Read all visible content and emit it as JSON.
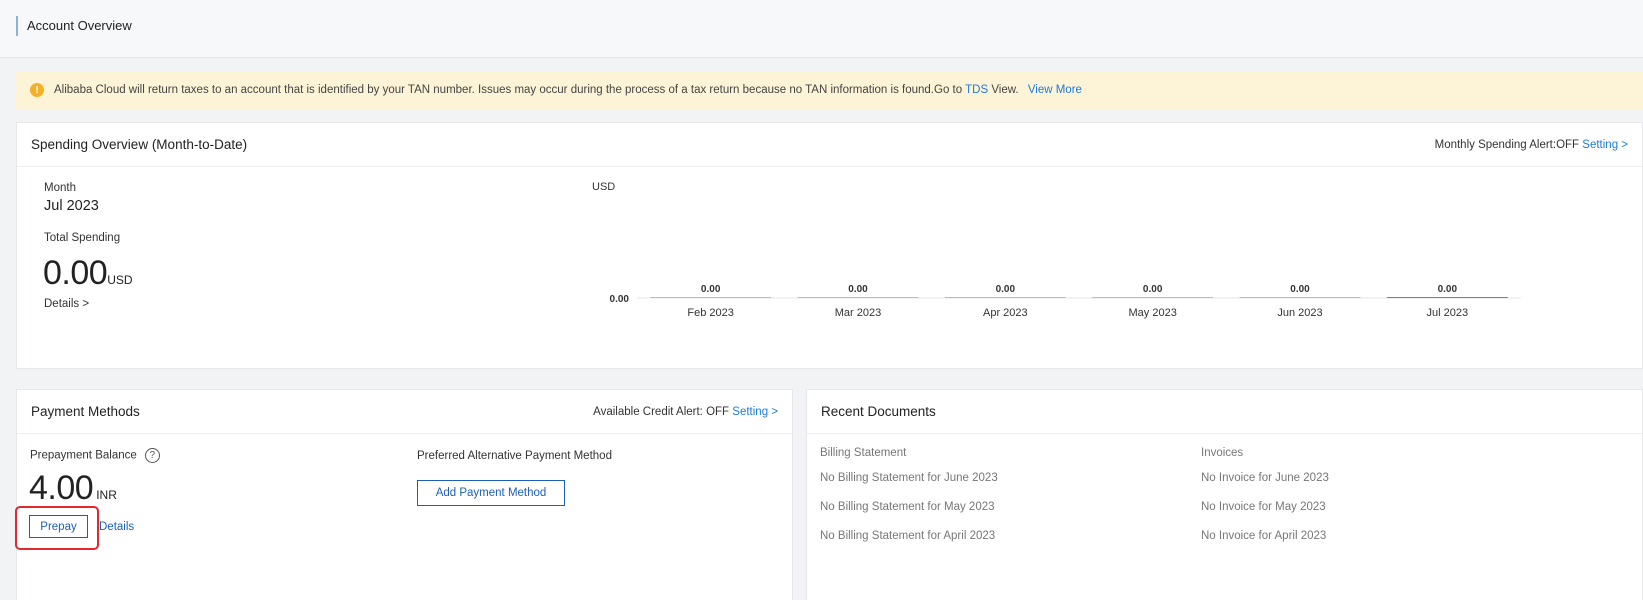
{
  "page": {
    "title": "Account Overview"
  },
  "notice": {
    "text": "Alibaba Cloud will return taxes to an account that is identified by your TAN number. Issues may occur during the process of a tax return because no TAN information is found.Go to ",
    "tds_link": "TDS",
    "view_text": " View.",
    "view_more": "View More"
  },
  "spending": {
    "title": "Spending Overview (Month-to-Date)",
    "alert_text": "Monthly Spending Alert:OFF",
    "setting_link": "Setting >",
    "month_label": "Month",
    "month_value": "Jul 2023",
    "total_label": "Total Spending",
    "total_value": "0.00",
    "total_unit": "USD",
    "details_link": "Details >"
  },
  "chart_data": {
    "type": "bar",
    "ylabel": "USD",
    "categories": [
      "Feb 2023",
      "Mar 2023",
      "Apr 2023",
      "May 2023",
      "Jun 2023",
      "Jul 2023"
    ],
    "values": [
      0.0,
      0.0,
      0.0,
      0.0,
      0.0,
      0.0
    ],
    "value_labels": [
      "0.00",
      "0.00",
      "0.00",
      "0.00",
      "0.00",
      "0.00"
    ],
    "y_ticks": [
      "0.00"
    ],
    "colors": {
      "bar": "#8fd3c7",
      "bar_last": "#2fa58e",
      "axis": "#e3e5e8"
    }
  },
  "payment": {
    "title": "Payment Methods",
    "alert_text": "Available Credit Alert: OFF",
    "setting_link": "Setting >",
    "balance_label": "Prepayment Balance",
    "balance_value": "4.00",
    "balance_unit": "INR",
    "prepay_button": "Prepay",
    "details_link": "Details",
    "preferred_label": "Preferred Alternative Payment Method",
    "add_button": "Add Payment Method"
  },
  "documents": {
    "title": "Recent Documents",
    "billing_header": "Billing Statement",
    "invoice_header": "Invoices",
    "billing_items": [
      "No Billing Statement for June 2023",
      "No Billing Statement for May 2023",
      "No Billing Statement for April 2023"
    ],
    "invoice_items": [
      "No Invoice for June 2023",
      "No Invoice for May 2023",
      "No Invoice for April 2023"
    ]
  },
  "colors": {
    "link": "#1d7ad8",
    "notice_bg": "#fdf3d6",
    "warn": "#f5b025",
    "highlight": "#e0282e"
  }
}
